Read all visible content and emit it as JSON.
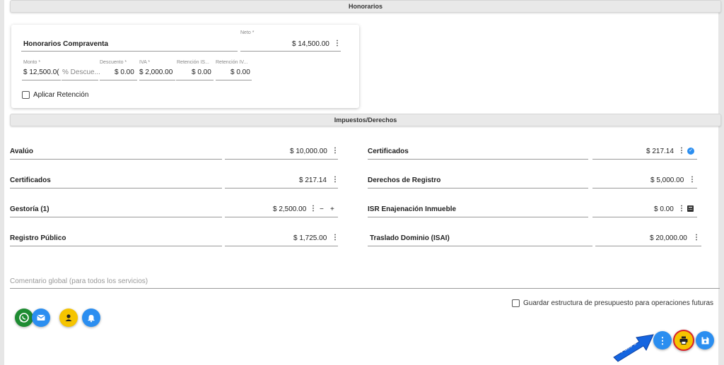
{
  "honorarios": {
    "section_title": "Honorarios",
    "item_title": "Honorarios Compraventa",
    "neto_label": "Neto *",
    "neto_value": "$ 14,500.00",
    "fields": [
      {
        "label": "Monto *",
        "value": "$ 12,500.0("
      },
      {
        "label": "",
        "placeholder": "% Descue..."
      },
      {
        "label": "Descuento *",
        "value": "$ 0.00"
      },
      {
        "label": "IVA *",
        "value": "$ 2,000.00"
      },
      {
        "label": "Retención IS...",
        "value": "$ 0.00"
      },
      {
        "label": "Retención IV...",
        "value": "$ 0.00"
      }
    ],
    "aplicar_retencion": "Aplicar Retención"
  },
  "impuestos": {
    "section_title": "Impuestos/Derechos",
    "left": [
      {
        "label": "Avalúo",
        "value": "$ 10,000.00"
      },
      {
        "label": "Certificados",
        "value": "$ 217.14"
      },
      {
        "label": "Gestoría (1)",
        "value": "$ 2,500.00",
        "minus": "−",
        "plus": "+"
      },
      {
        "label": "Registro Público",
        "value": "$ 1,725.00"
      }
    ],
    "right": [
      {
        "label": "Certificados",
        "value": "$ 217.14"
      },
      {
        "label": "Derechos de Registro",
        "value": "$ 5,000.00"
      },
      {
        "label": "ISR Enajenación Inmueble",
        "value": "$ 0.00"
      },
      {
        "label": "Traslado Dominio (ISAI)",
        "value": "$ 20,000.00"
      }
    ]
  },
  "comment_placeholder": "Comentario global (para todos los servicios)",
  "guardar_estructura": "Guardar estructura de presupuesto para operaciones futuras",
  "callout_label": "Paso 6",
  "colors": {
    "whatsapp": "#1e8c32",
    "email": "#2b8ef0",
    "user": "#f5c400",
    "bell": "#2b8ef0",
    "action_blue": "#2b8ef0",
    "print_yellow": "#f5c400",
    "print_ring": "#d9222a",
    "callout_blue": "#1565e0"
  }
}
